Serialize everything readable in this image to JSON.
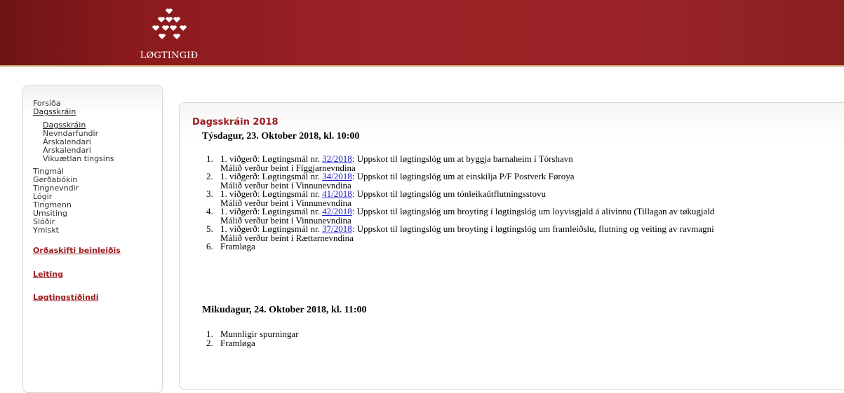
{
  "header": {
    "logo_text": "LØGTINGIÐ",
    "logo_icon": "hearts-emblem-icon",
    "colors": {
      "bg": "#9b2226",
      "logo": "#ffffff"
    }
  },
  "sidebar": {
    "items": [
      {
        "label": "Forsíða"
      },
      {
        "label": "Dagsskráin"
      },
      {
        "label": "Dagsskráin"
      },
      {
        "label": "Nevndarfundir"
      },
      {
        "label": "Árskalendari"
      },
      {
        "label": "Árskalendari"
      },
      {
        "label": "Vikuætlan tingsins"
      },
      {
        "label": "Tingmál"
      },
      {
        "label": "Gerðabókin"
      },
      {
        "label": "Tingnevndir"
      },
      {
        "label": "Lógir"
      },
      {
        "label": "Tingmenn"
      },
      {
        "label": "Umsiting"
      },
      {
        "label": "Slóðir"
      },
      {
        "label": "Ymiskt"
      }
    ],
    "links": [
      {
        "label": "Orðaskifti beinleiðis"
      },
      {
        "label": "Leiting"
      },
      {
        "label": "Løgtingstíðindi"
      }
    ]
  },
  "main": {
    "title": "Dagsskráin 2018",
    "days": [
      {
        "heading": "Týsdagur, 23. Oktober 2018, kl. 10:00",
        "items": [
          {
            "num": "1.",
            "prefix": "1. viðgerð: Løgtingsmál nr. ",
            "link": "32/2018",
            "text": ": Uppskot til løgtingslóg um at byggja barnaheim í Tórshavn",
            "note": "Málið verður beint í Fíggjarnevndina"
          },
          {
            "num": "2.",
            "prefix": "1. viðgerð: Løgtingsmál nr. ",
            "link": "34/2018",
            "text": ": Uppskot til løgtingslóg um at einskilja P/F Postverk Føroya",
            "note": "Málið verður beint í Vinnunevndina"
          },
          {
            "num": "3.",
            "prefix": "1. viðgerð: Løgtingsmál nr. ",
            "link": "41/2018",
            "text": ": Uppskot til løgtingslóg um tónleikaútflutningsstovu",
            "note": "Málið verður beint í Vinnunevndina"
          },
          {
            "num": "4.",
            "prefix": "1. viðgerð: Løgtingsmál nr. ",
            "link": "42/2018",
            "text": ": Uppskot til løgtingslóg um broyting í løgtingslóg um loyvisgjald á alivinnu (Tillagan av tøkugjald",
            "note": "Málið verður beint í Vinnunevndina"
          },
          {
            "num": "5.",
            "prefix": "1. viðgerð: Løgtingsmál nr. ",
            "link": "37/2018",
            "text": ": Uppskot til løgtingslóg um broyting í løgtingslóg um framleiðslu, flutning og veiting av ravmagni",
            "note": "Málið verður beint í Rættarnevndina"
          },
          {
            "num": "6.",
            "prefix": "Framløga",
            "link": "",
            "text": "",
            "note": ""
          }
        ]
      },
      {
        "heading": "Mikudagur, 24. Oktober 2018, kl. 11:00",
        "items": [
          {
            "num": "1.",
            "prefix": "Munnligir spurningar",
            "link": "",
            "text": "",
            "note": ""
          },
          {
            "num": "2.",
            "prefix": "Framløga",
            "link": "",
            "text": "",
            "note": ""
          }
        ]
      }
    ]
  }
}
